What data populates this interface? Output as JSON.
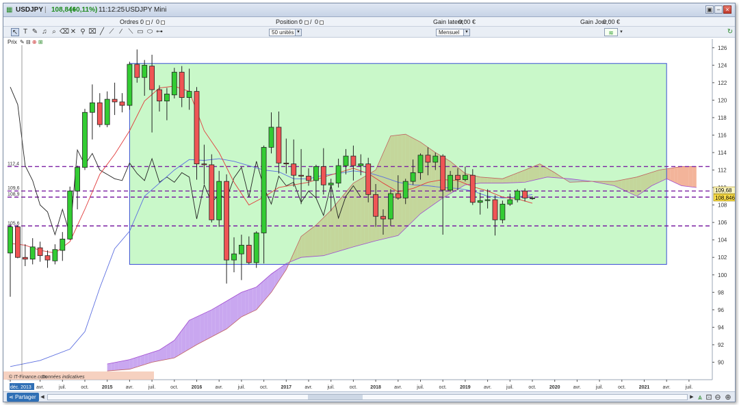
{
  "titlebar": {
    "instrument": "USDJPY",
    "price": "108,846",
    "change": "(+0,11%)",
    "time": "11:12:25",
    "name": "USDJPY Mini"
  },
  "orderbar": {
    "orders_label": "Ordres :",
    "orders_value": "0",
    "orders_sep": "/",
    "orders_value2": "0",
    "position_label": "Position :",
    "position_value": "0",
    "position_value2": "0",
    "latent_label": "Gain latent :",
    "latent_value": "0,00 €",
    "day_label": "Gain Jour :",
    "day_value": "0,00 €"
  },
  "toolbar": {
    "units_select": "50 unités",
    "period_select": "Mensuel"
  },
  "prix_label": "Prix",
  "footer": {
    "source": "© IT-Finance.com",
    "note": "Données indicatives",
    "share": "Partager"
  },
  "colors": {
    "bull": "#33cc33",
    "bear": "#ef5555",
    "tenkan": "#e13b3b",
    "kijun": "#5b6ee0",
    "chikou": "#222222",
    "kumo_bull": "#c9a7f0",
    "kumo_bear": "#f3b49a",
    "box_fill": "#9df29d",
    "box_border": "#3b4fd6",
    "dash": "#7a1fa2"
  },
  "chart_data": {
    "type": "candlestick",
    "instrument": "USDJPY",
    "period": "monthly",
    "ylim": [
      88,
      127
    ],
    "y_ticks": [
      90,
      92,
      94,
      96,
      98,
      100,
      102,
      104,
      106,
      108,
      110,
      112,
      114,
      116,
      118,
      120,
      122,
      124,
      126
    ],
    "y_tick_labels": [
      "90",
      "92",
      "94",
      "96",
      "98",
      "100",
      "102",
      "104",
      "106",
      "108",
      "110",
      "112",
      "114",
      "116",
      "118",
      "120",
      "122",
      "124",
      "126"
    ],
    "x_ticks": [
      {
        "i": 0,
        "label": "déc. 2013"
      },
      {
        "i": 4,
        "label": "avr."
      },
      {
        "i": 7,
        "label": "juil."
      },
      {
        "i": 10,
        "label": "oct."
      },
      {
        "i": 13,
        "label": "2015"
      },
      {
        "i": 16,
        "label": "avr."
      },
      {
        "i": 19,
        "label": "juil."
      },
      {
        "i": 22,
        "label": "oct."
      },
      {
        "i": 25,
        "label": "2016"
      },
      {
        "i": 28,
        "label": "avr."
      },
      {
        "i": 31,
        "label": "juil."
      },
      {
        "i": 34,
        "label": "oct."
      },
      {
        "i": 37,
        "label": "2017"
      },
      {
        "i": 40,
        "label": "avr."
      },
      {
        "i": 43,
        "label": "juil."
      },
      {
        "i": 46,
        "label": "oct."
      },
      {
        "i": 49,
        "label": "2018"
      },
      {
        "i": 52,
        "label": "avr."
      },
      {
        "i": 55,
        "label": "juil."
      },
      {
        "i": 58,
        "label": "oct."
      },
      {
        "i": 61,
        "label": "2019"
      },
      {
        "i": 64,
        "label": "avr."
      },
      {
        "i": 67,
        "label": "juil."
      },
      {
        "i": 70,
        "label": "oct."
      },
      {
        "i": 73,
        "label": "2020"
      },
      {
        "i": 76,
        "label": "avr."
      },
      {
        "i": 79,
        "label": "juil."
      },
      {
        "i": 82,
        "label": "oct."
      },
      {
        "i": 85,
        "label": "2021"
      },
      {
        "i": 88,
        "label": "avr."
      },
      {
        "i": 91,
        "label": "juil."
      }
    ],
    "candles": [
      [
        0,
        102.5,
        105.5,
        105.8,
        97.5
      ],
      [
        1,
        105.5,
        102.0,
        105.7,
        101.9
      ],
      [
        2,
        102.0,
        101.8,
        103.5,
        101.0
      ],
      [
        3,
        101.8,
        103.2,
        104.2,
        101.2
      ],
      [
        4,
        103.1,
        102.2,
        103.8,
        101.5
      ],
      [
        5,
        102.2,
        101.7,
        102.8,
        100.8
      ],
      [
        6,
        101.6,
        102.9,
        103.5,
        101.2
      ],
      [
        7,
        102.8,
        104.1,
        104.9,
        101.6
      ],
      [
        8,
        104.1,
        109.6,
        110.1,
        104.0
      ],
      [
        9,
        109.6,
        112.3,
        112.5,
        107.5
      ],
      [
        10,
        112.3,
        118.6,
        119.0,
        112.0
      ],
      [
        11,
        118.6,
        119.7,
        121.8,
        115.5
      ],
      [
        12,
        119.7,
        117.2,
        120.8,
        116.9
      ],
      [
        13,
        117.2,
        120.1,
        121.0,
        116.9
      ],
      [
        14,
        120.1,
        119.8,
        122.0,
        118.3
      ],
      [
        15,
        119.8,
        119.4,
        120.8,
        118.6
      ],
      [
        16,
        119.4,
        124.1,
        124.4,
        118.9
      ],
      [
        17,
        124.1,
        122.6,
        125.8,
        122.0
      ],
      [
        18,
        122.6,
        124.0,
        124.6,
        120.5
      ],
      [
        19,
        123.9,
        121.2,
        125.2,
        116.3
      ],
      [
        20,
        121.2,
        119.9,
        121.7,
        118.7
      ],
      [
        21,
        119.9,
        120.7,
        121.4,
        117.7
      ],
      [
        22,
        120.6,
        123.2,
        123.7,
        120.2
      ],
      [
        23,
        123.2,
        120.3,
        123.9,
        119.2
      ],
      [
        24,
        120.3,
        121.0,
        123.6,
        118.9
      ],
      [
        25,
        121.0,
        112.7,
        121.5,
        110.9
      ],
      [
        26,
        112.7,
        112.6,
        114.9,
        110.4
      ],
      [
        27,
        112.6,
        106.3,
        113.8,
        106.0
      ],
      [
        28,
        106.3,
        110.7,
        111.9,
        105.5
      ],
      [
        29,
        110.7,
        101.7,
        111.5,
        99.0
      ],
      [
        30,
        101.7,
        102.4,
        104.3,
        100.3
      ],
      [
        31,
        102.4,
        103.4,
        104.6,
        99.4
      ],
      [
        32,
        103.4,
        101.4,
        104.4,
        101.2
      ],
      [
        33,
        101.4,
        104.8,
        105.0,
        100.8
      ],
      [
        34,
        104.8,
        114.6,
        114.8,
        101.3
      ],
      [
        35,
        114.6,
        116.9,
        118.6,
        113.9
      ],
      [
        36,
        116.9,
        112.8,
        118.7,
        111.6
      ],
      [
        37,
        112.8,
        112.7,
        115.6,
        111.6
      ],
      [
        38,
        112.7,
        111.4,
        115.5,
        110.1
      ],
      [
        39,
        111.4,
        111.3,
        114.4,
        108.1
      ],
      [
        40,
        111.3,
        110.8,
        112.2,
        110.2
      ],
      [
        41,
        110.8,
        112.4,
        112.6,
        108.8
      ],
      [
        42,
        112.4,
        110.3,
        114.5,
        109.2
      ],
      [
        43,
        110.3,
        110.5,
        111.0,
        107.3
      ],
      [
        44,
        110.5,
        112.5,
        113.3,
        110.0
      ],
      [
        45,
        112.5,
        113.6,
        114.4,
        111.5
      ],
      [
        46,
        113.6,
        112.5,
        114.8,
        110.8
      ],
      [
        47,
        112.5,
        112.7,
        113.8,
        111.4
      ],
      [
        48,
        112.7,
        109.2,
        113.4,
        108.3
      ],
      [
        49,
        109.2,
        106.7,
        110.4,
        105.5
      ],
      [
        50,
        106.7,
        106.4,
        107.5,
        104.6
      ],
      [
        51,
        106.4,
        109.3,
        109.8,
        105.6
      ],
      [
        52,
        109.3,
        108.8,
        111.4,
        108.6
      ],
      [
        53,
        108.8,
        110.7,
        111.0,
        108.1
      ],
      [
        54,
        110.7,
        111.7,
        113.2,
        110.3
      ],
      [
        55,
        111.7,
        113.7,
        113.9,
        110.9
      ],
      [
        56,
        113.7,
        112.9,
        114.6,
        111.4
      ],
      [
        57,
        112.9,
        113.6,
        114.0,
        112.0
      ],
      [
        58,
        113.6,
        109.7,
        113.8,
        104.6
      ],
      [
        59,
        109.7,
        111.4,
        111.9,
        109.5
      ],
      [
        60,
        111.4,
        110.9,
        112.2,
        109.7
      ],
      [
        61,
        110.9,
        111.4,
        112.4,
        110.7
      ],
      [
        62,
        111.4,
        108.3,
        112.1,
        108.0
      ],
      [
        63,
        108.3,
        108.5,
        109.4,
        106.9
      ],
      [
        64,
        108.5,
        108.6,
        109.8,
        107.6
      ],
      [
        65,
        108.6,
        106.3,
        109.1,
        104.5
      ],
      [
        66,
        106.3,
        108.1,
        108.5,
        105.9
      ],
      [
        67,
        108.1,
        108.6,
        109.3,
        107.9
      ],
      [
        68,
        108.6,
        109.6,
        109.8,
        108.3
      ],
      [
        69,
        109.6,
        108.8,
        109.9,
        108.4
      ],
      [
        70,
        108.8,
        108.8,
        109.0,
        108.6
      ]
    ],
    "tenkan": [
      [
        0,
        103.6
      ],
      [
        2,
        103.4
      ],
      [
        4,
        102.8
      ],
      [
        6,
        102.5
      ],
      [
        8,
        103.8
      ],
      [
        10,
        107.5
      ],
      [
        12,
        111.5
      ],
      [
        14,
        113.8
      ],
      [
        16,
        116.5
      ],
      [
        18,
        119.9
      ],
      [
        20,
        121.4
      ],
      [
        22,
        121.6
      ],
      [
        24,
        121.0
      ],
      [
        26,
        116.5
      ],
      [
        28,
        114.0
      ],
      [
        30,
        110.6
      ],
      [
        32,
        108.0
      ],
      [
        34,
        108.9
      ],
      [
        36,
        110.0
      ],
      [
        38,
        110.3
      ],
      [
        40,
        110.6
      ],
      [
        42,
        111.2
      ],
      [
        44,
        111.7
      ],
      [
        46,
        112.2
      ],
      [
        48,
        111.6
      ],
      [
        50,
        110.5
      ],
      [
        52,
        109.5
      ],
      [
        54,
        109.9
      ],
      [
        56,
        110.6
      ],
      [
        58,
        110.9
      ],
      [
        60,
        110.8
      ],
      [
        62,
        110.1
      ],
      [
        64,
        109.6
      ],
      [
        66,
        108.9
      ],
      [
        68,
        108.7
      ],
      [
        70,
        108.2
      ]
    ],
    "kijun": [
      [
        0,
        89.5
      ],
      [
        4,
        90.2
      ],
      [
        8,
        91.5
      ],
      [
        10,
        93.5
      ],
      [
        12,
        98.5
      ],
      [
        14,
        103.0
      ],
      [
        16,
        105.0
      ],
      [
        18,
        109.0
      ],
      [
        20,
        110.5
      ],
      [
        22,
        112.0
      ],
      [
        24,
        113.2
      ],
      [
        26,
        113.1
      ],
      [
        28,
        113.3
      ],
      [
        30,
        113.0
      ],
      [
        32,
        112.5
      ],
      [
        34,
        112.0
      ],
      [
        36,
        111.8
      ],
      [
        38,
        111.0
      ],
      [
        40,
        111.0
      ],
      [
        42,
        111.4
      ],
      [
        44,
        111.6
      ],
      [
        46,
        111.9
      ],
      [
        48,
        111.7
      ],
      [
        50,
        111.2
      ],
      [
        52,
        110.6
      ],
      [
        54,
        110.3
      ],
      [
        56,
        110.2
      ],
      [
        58,
        110.0
      ],
      [
        60,
        109.9
      ],
      [
        62,
        109.6
      ],
      [
        64,
        109.0
      ],
      [
        66,
        108.8
      ],
      [
        68,
        108.9
      ],
      [
        70,
        109.2
      ]
    ],
    "chikou": [
      [
        0,
        121.5
      ],
      [
        1,
        119.5
      ],
      [
        2,
        112.5
      ],
      [
        3,
        110.8
      ],
      [
        4,
        108.0
      ],
      [
        5,
        107.2
      ],
      [
        6,
        104.6
      ],
      [
        7,
        107.5
      ],
      [
        8,
        104.6
      ],
      [
        9,
        114.3
      ],
      [
        10,
        112.6
      ],
      [
        11,
        113.9
      ],
      [
        12,
        112.0
      ],
      [
        13,
        111.5
      ],
      [
        14,
        111.0
      ],
      [
        15,
        110.8
      ],
      [
        16,
        112.8
      ],
      [
        17,
        111.6
      ],
      [
        18,
        110.8
      ],
      [
        19,
        113.3
      ],
      [
        20,
        110.6
      ],
      [
        21,
        111.2
      ],
      [
        22,
        110.6
      ],
      [
        23,
        111.7
      ],
      [
        24,
        111.2
      ],
      [
        25,
        106.4
      ],
      [
        26,
        110.3
      ],
      [
        27,
        108.3
      ],
      [
        28,
        109.2
      ],
      [
        29,
        108.7
      ],
      [
        30,
        111.1
      ],
      [
        31,
        112.3
      ],
      [
        32,
        108.9
      ],
      [
        33,
        113.0
      ],
      [
        34,
        110.0
      ],
      [
        35,
        108.1
      ],
      [
        36,
        111.3
      ],
      [
        37,
        110.2
      ],
      [
        38,
        110.6
      ],
      [
        39,
        108.3
      ],
      [
        40,
        109.6
      ],
      [
        41,
        108.8
      ],
      [
        42,
        106.8
      ],
      [
        43,
        110.3
      ],
      [
        44,
        106.5
      ],
      [
        45,
        109.0
      ],
      [
        46,
        110.2
      ],
      [
        47,
        108.9
      ]
    ],
    "senkou_a": [
      [
        13,
        89.8
      ],
      [
        16,
        90.3
      ],
      [
        20,
        91.4
      ],
      [
        22,
        92.5
      ],
      [
        24,
        94.8
      ],
      [
        27,
        96.0
      ],
      [
        29,
        97.0
      ],
      [
        31,
        98.0
      ],
      [
        33,
        98.6
      ],
      [
        35,
        100.1
      ],
      [
        37,
        101.3
      ],
      [
        39,
        102.0
      ],
      [
        42,
        102.2
      ],
      [
        46,
        103.2
      ],
      [
        49,
        103.9
      ],
      [
        52,
        104.5
      ],
      [
        55,
        107.0
      ],
      [
        58,
        108.8
      ],
      [
        61,
        110.3
      ],
      [
        63,
        110.5
      ],
      [
        66,
        110.5
      ],
      [
        69,
        110.6
      ],
      [
        72,
        111.2
      ],
      [
        75,
        111.0
      ],
      [
        78,
        110.7
      ],
      [
        81,
        110.2
      ],
      [
        84,
        109.0
      ],
      [
        86,
        110.2
      ],
      [
        88,
        111.0
      ],
      [
        90,
        110.2
      ],
      [
        92,
        110.0
      ]
    ],
    "senkou_b": [
      [
        13,
        89.0
      ],
      [
        16,
        89.2
      ],
      [
        19,
        90.0
      ],
      [
        22,
        90.5
      ],
      [
        25,
        92.0
      ],
      [
        29,
        93.8
      ],
      [
        31,
        95.2
      ],
      [
        33,
        96.0
      ],
      [
        35,
        98.0
      ],
      [
        37,
        100.6
      ],
      [
        39,
        104.4
      ],
      [
        41,
        105.7
      ],
      [
        43,
        107.4
      ],
      [
        46,
        110.5
      ],
      [
        49,
        112.0
      ],
      [
        51,
        115.9
      ],
      [
        53,
        116.1
      ],
      [
        55,
        115.2
      ],
      [
        57,
        114.0
      ],
      [
        59,
        113.0
      ],
      [
        61,
        111.6
      ],
      [
        63,
        111.2
      ],
      [
        66,
        111.0
      ],
      [
        69,
        112.0
      ],
      [
        71,
        112.7
      ],
      [
        73,
        111.7
      ],
      [
        75,
        110.6
      ],
      [
        78,
        110.7
      ],
      [
        81,
        110.7
      ],
      [
        84,
        111.2
      ],
      [
        87,
        112.0
      ],
      [
        90,
        112.4
      ],
      [
        92,
        112.4
      ]
    ],
    "box": {
      "i_start": 16,
      "i_end": 88,
      "y_low": 101.2,
      "y_high": 124.2
    },
    "levels": [
      {
        "value": 112.4,
        "label": "112,4"
      },
      {
        "value": 109.6,
        "label": "109,6"
      },
      {
        "value": 108.9,
        "label": "108,9"
      },
      {
        "value": 105.6,
        "label": "105,6"
      }
    ],
    "current_price": {
      "value": 108.846,
      "label": "108,846"
    },
    "cloud_price": {
      "value": 109.68,
      "label": "109,68"
    }
  }
}
